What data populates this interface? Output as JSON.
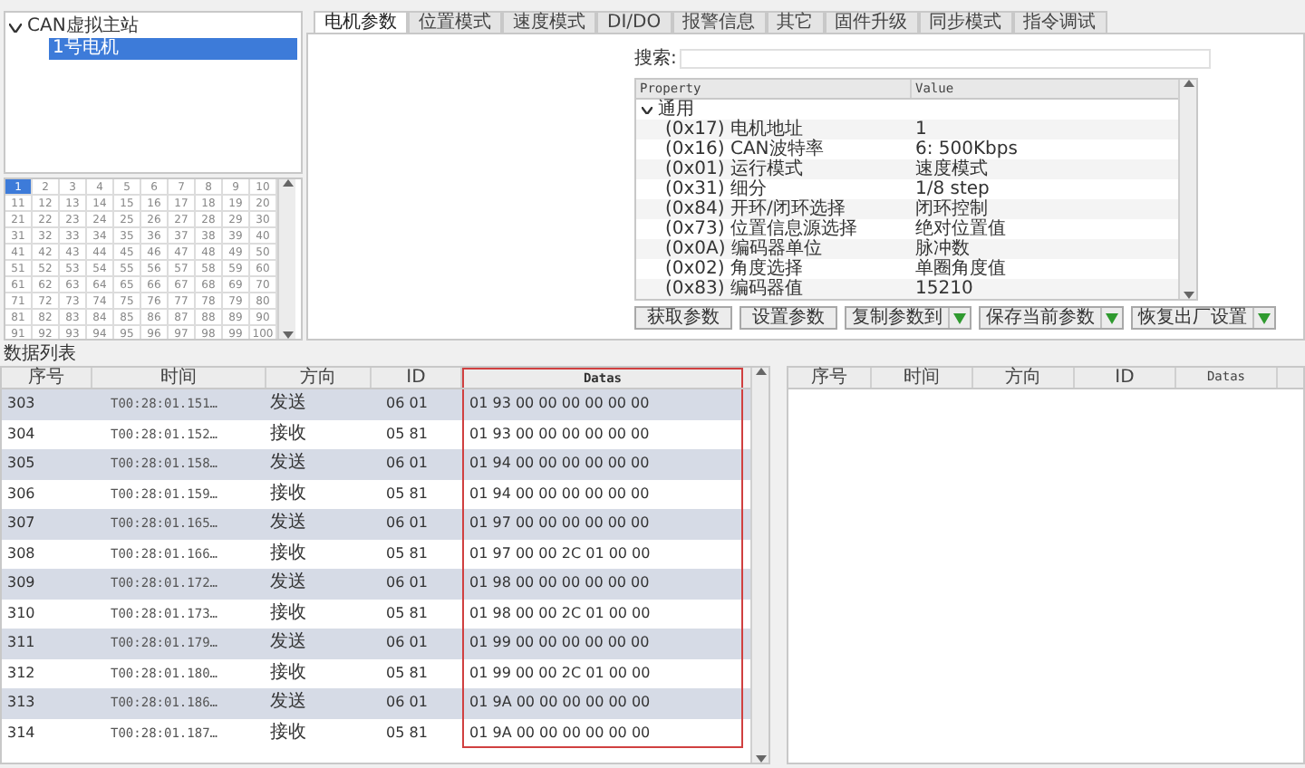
{
  "tree": {
    "root": {
      "label": "CAN虚拟主站",
      "expanded": true,
      "children": [
        {
          "label": "1号电机",
          "selected": true
        }
      ]
    }
  },
  "grid": {
    "rows": [
      [
        {
          "n": "1",
          "selected": true
        },
        {
          "n": "2",
          "selected": false
        },
        {
          "n": "3",
          "selected": false
        },
        {
          "n": "4",
          "selected": false
        },
        {
          "n": "5",
          "selected": false
        },
        {
          "n": "6",
          "selected": false
        },
        {
          "n": "7",
          "selected": false
        },
        {
          "n": "8",
          "selected": false
        },
        {
          "n": "9",
          "selected": false
        },
        {
          "n": "10",
          "selected": false
        }
      ],
      [
        {
          "n": "11",
          "selected": false
        },
        {
          "n": "12",
          "selected": false
        },
        {
          "n": "13",
          "selected": false
        },
        {
          "n": "14",
          "selected": false
        },
        {
          "n": "15",
          "selected": false
        },
        {
          "n": "16",
          "selected": false
        },
        {
          "n": "17",
          "selected": false
        },
        {
          "n": "18",
          "selected": false
        },
        {
          "n": "19",
          "selected": false
        },
        {
          "n": "20",
          "selected": false
        }
      ],
      [
        {
          "n": "21",
          "selected": false
        },
        {
          "n": "22",
          "selected": false
        },
        {
          "n": "23",
          "selected": false
        },
        {
          "n": "24",
          "selected": false
        },
        {
          "n": "25",
          "selected": false
        },
        {
          "n": "26",
          "selected": false
        },
        {
          "n": "27",
          "selected": false
        },
        {
          "n": "28",
          "selected": false
        },
        {
          "n": "29",
          "selected": false
        },
        {
          "n": "30",
          "selected": false
        }
      ],
      [
        {
          "n": "31",
          "selected": false
        },
        {
          "n": "32",
          "selected": false
        },
        {
          "n": "33",
          "selected": false
        },
        {
          "n": "34",
          "selected": false
        },
        {
          "n": "35",
          "selected": false
        },
        {
          "n": "36",
          "selected": false
        },
        {
          "n": "37",
          "selected": false
        },
        {
          "n": "38",
          "selected": false
        },
        {
          "n": "39",
          "selected": false
        },
        {
          "n": "40",
          "selected": false
        }
      ],
      [
        {
          "n": "41",
          "selected": false
        },
        {
          "n": "42",
          "selected": false
        },
        {
          "n": "43",
          "selected": false
        },
        {
          "n": "44",
          "selected": false
        },
        {
          "n": "45",
          "selected": false
        },
        {
          "n": "46",
          "selected": false
        },
        {
          "n": "47",
          "selected": false
        },
        {
          "n": "48",
          "selected": false
        },
        {
          "n": "49",
          "selected": false
        },
        {
          "n": "50",
          "selected": false
        }
      ],
      [
        {
          "n": "51",
          "selected": false
        },
        {
          "n": "52",
          "selected": false
        },
        {
          "n": "53",
          "selected": false
        },
        {
          "n": "54",
          "selected": false
        },
        {
          "n": "55",
          "selected": false
        },
        {
          "n": "56",
          "selected": false
        },
        {
          "n": "57",
          "selected": false
        },
        {
          "n": "58",
          "selected": false
        },
        {
          "n": "59",
          "selected": false
        },
        {
          "n": "60",
          "selected": false
        }
      ],
      [
        {
          "n": "61",
          "selected": false
        },
        {
          "n": "62",
          "selected": false
        },
        {
          "n": "63",
          "selected": false
        },
        {
          "n": "64",
          "selected": false
        },
        {
          "n": "65",
          "selected": false
        },
        {
          "n": "66",
          "selected": false
        },
        {
          "n": "67",
          "selected": false
        },
        {
          "n": "68",
          "selected": false
        },
        {
          "n": "69",
          "selected": false
        },
        {
          "n": "70",
          "selected": false
        }
      ],
      [
        {
          "n": "71",
          "selected": false
        },
        {
          "n": "72",
          "selected": false
        },
        {
          "n": "73",
          "selected": false
        },
        {
          "n": "74",
          "selected": false
        },
        {
          "n": "75",
          "selected": false
        },
        {
          "n": "76",
          "selected": false
        },
        {
          "n": "77",
          "selected": false
        },
        {
          "n": "78",
          "selected": false
        },
        {
          "n": "79",
          "selected": false
        },
        {
          "n": "80",
          "selected": false
        }
      ],
      [
        {
          "n": "81",
          "selected": false
        },
        {
          "n": "82",
          "selected": false
        },
        {
          "n": "83",
          "selected": false
        },
        {
          "n": "84",
          "selected": false
        },
        {
          "n": "85",
          "selected": false
        },
        {
          "n": "86",
          "selected": false
        },
        {
          "n": "87",
          "selected": false
        },
        {
          "n": "88",
          "selected": false
        },
        {
          "n": "89",
          "selected": false
        },
        {
          "n": "90",
          "selected": false
        }
      ],
      [
        {
          "n": "91",
          "selected": false
        },
        {
          "n": "92",
          "selected": false
        },
        {
          "n": "93",
          "selected": false
        },
        {
          "n": "94",
          "selected": false
        },
        {
          "n": "95",
          "selected": false
        },
        {
          "n": "96",
          "selected": false
        },
        {
          "n": "97",
          "selected": false
        },
        {
          "n": "98",
          "selected": false
        },
        {
          "n": "99",
          "selected": false
        },
        {
          "n": "100",
          "selected": false
        }
      ]
    ]
  },
  "tabs": [
    {
      "label": "电机参数",
      "selected": true
    },
    {
      "label": "位置模式",
      "selected": false
    },
    {
      "label": "速度模式",
      "selected": false
    },
    {
      "label": "DI/DO",
      "selected": false
    },
    {
      "label": "报警信息",
      "selected": false
    },
    {
      "label": "其它",
      "selected": false
    },
    {
      "label": "固件升级",
      "selected": false
    },
    {
      "label": "同步模式",
      "selected": false
    },
    {
      "label": "指令调试",
      "selected": false
    }
  ],
  "search": {
    "label": "搜索:"
  },
  "property_grid": {
    "columns": [
      "Property",
      "Value"
    ],
    "group": {
      "label": "通用",
      "expanded": true
    },
    "rows": [
      {
        "property": "(0x17) 电机地址",
        "value": "1"
      },
      {
        "property": "(0x16) CAN波特率",
        "value": "6: 500Kbps"
      },
      {
        "property": "(0x01) 运行模式",
        "value": "速度模式"
      },
      {
        "property": "(0x31) 细分",
        "value": "1/8 step"
      },
      {
        "property": "(0x84) 开环/闭环选择",
        "value": "闭环控制"
      },
      {
        "property": "(0x73) 位置信息源选择",
        "value": "绝对位置值"
      },
      {
        "property": "(0x0A) 编码器单位",
        "value": "脉冲数"
      },
      {
        "property": "(0x02) 角度选择",
        "value": "单圈角度值"
      },
      {
        "property": "(0x83) 编码器值",
        "value": "15210"
      }
    ]
  },
  "buttons": [
    {
      "label": "获取参数",
      "kind": "plain"
    },
    {
      "label": "设置参数",
      "kind": "plain"
    },
    {
      "label": "复制参数到",
      "kind": "split"
    },
    {
      "label": "保存当前参数",
      "kind": "split"
    },
    {
      "label": "恢复出厂设置",
      "kind": "split"
    }
  ],
  "data_list": {
    "title": "数据列表",
    "columns": [
      "序号",
      "时间",
      "方向",
      "ID",
      "Datas"
    ],
    "rows": [
      [
        "303",
        "T00:28:01.151…",
        "发送",
        "06 01",
        "01 93 00 00 00 00 00 00"
      ],
      [
        "304",
        "T00:28:01.152…",
        "接收",
        "05 81",
        "01 93 00 00 00 00 00 00"
      ],
      [
        "305",
        "T00:28:01.158…",
        "发送",
        "06 01",
        "01 94 00 00 00 00 00 00"
      ],
      [
        "306",
        "T00:28:01.159…",
        "接收",
        "05 81",
        "01 94 00 00 00 00 00 00"
      ],
      [
        "307",
        "T00:28:01.165…",
        "发送",
        "06 01",
        "01 97 00 00 00 00 00 00"
      ],
      [
        "308",
        "T00:28:01.166…",
        "接收",
        "05 81",
        "01 97 00 00 2C 01 00 00"
      ],
      [
        "309",
        "T00:28:01.172…",
        "发送",
        "06 01",
        "01 98 00 00 00 00 00 00"
      ],
      [
        "310",
        "T00:28:01.173…",
        "接收",
        "05 81",
        "01 98 00 00 2C 01 00 00"
      ],
      [
        "311",
        "T00:28:01.179…",
        "发送",
        "06 01",
        "01 99 00 00 00 00 00 00"
      ],
      [
        "312",
        "T00:28:01.180…",
        "接收",
        "05 81",
        "01 99 00 00 2C 01 00 00"
      ],
      [
        "313",
        "T00:28:01.186…",
        "发送",
        "06 01",
        "01 9A 00 00 00 00 00 00"
      ],
      [
        "314",
        "T00:28:01.187…",
        "接收",
        "05 81",
        "01 9A 00 00 00 00 00 00"
      ]
    ]
  },
  "second_list": {
    "columns": [
      "序号",
      "时间",
      "方向",
      "ID",
      "Datas"
    ]
  }
}
